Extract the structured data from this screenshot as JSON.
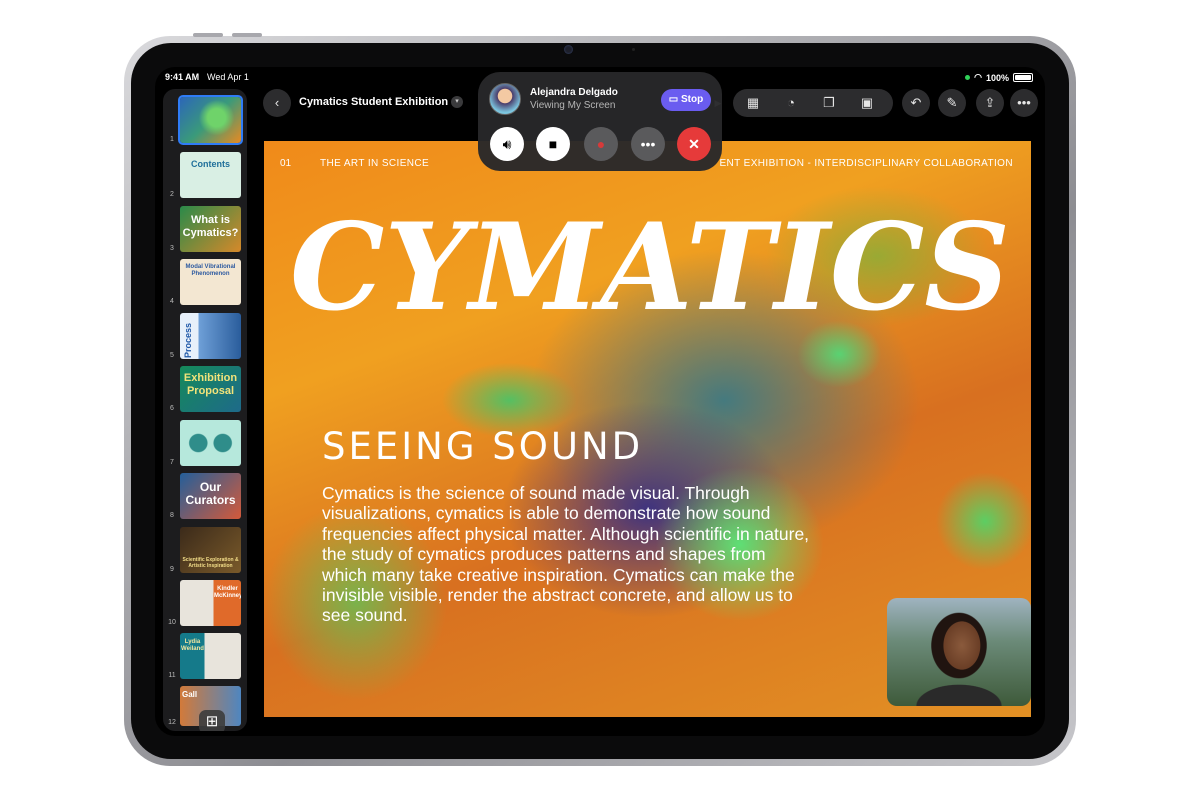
{
  "status_bar": {
    "time": "9:41 AM",
    "date": "Wed Apr 1",
    "battery": "100%"
  },
  "toolbar": {
    "document_title": "Cymatics Student Exhibition"
  },
  "facetime": {
    "caller_name": "Alejandra Delgado",
    "caller_status": "Viewing My Screen",
    "stop_label": "Stop"
  },
  "slide": {
    "number": "01",
    "header_left": "THE ART IN SCIENCE",
    "header_right": "ENT EXHIBITION - INTERDISCIPLINARY COLLABORATION",
    "title_art": "CYMATICS",
    "heading": "SEEING SOUND",
    "body": "Cymatics is the science of sound made visual. Through visualizations, cymatics is able to demonstrate how sound frequencies affect physical matter. Although scientific in nature, the study of cymatics produces patterns and shapes from which many take creative inspiration. Cymatics can make the invisible visible, render the abstract concrete, and allow us to see sound."
  },
  "navigator": {
    "slides": [
      {
        "num": "1",
        "title": ""
      },
      {
        "num": "2",
        "title": "Contents"
      },
      {
        "num": "3",
        "title": "What is Cymatics?"
      },
      {
        "num": "4",
        "title": "Modal Vibrational Phenomenon"
      },
      {
        "num": "5",
        "title": "Process"
      },
      {
        "num": "6",
        "title": "Exhibition Proposal"
      },
      {
        "num": "7",
        "title": ""
      },
      {
        "num": "8",
        "title": "Our Curators"
      },
      {
        "num": "9",
        "title": "Scientific Exploration & Artistic Inspiration"
      },
      {
        "num": "10",
        "title": "Kindler McKinney"
      },
      {
        "num": "11",
        "title": "Lydia Weiland"
      },
      {
        "num": "12",
        "title": "Gall"
      }
    ]
  },
  "icons": [
    "back-icon",
    "chevron-down-icon",
    "table-icon",
    "chart-icon",
    "shapes-icon",
    "media-icon",
    "undo-icon",
    "format-brush-icon",
    "share-icon",
    "more-icon",
    "speaker-icon",
    "video-icon",
    "mic-icon",
    "end-call-icon",
    "add-slide-icon"
  ]
}
